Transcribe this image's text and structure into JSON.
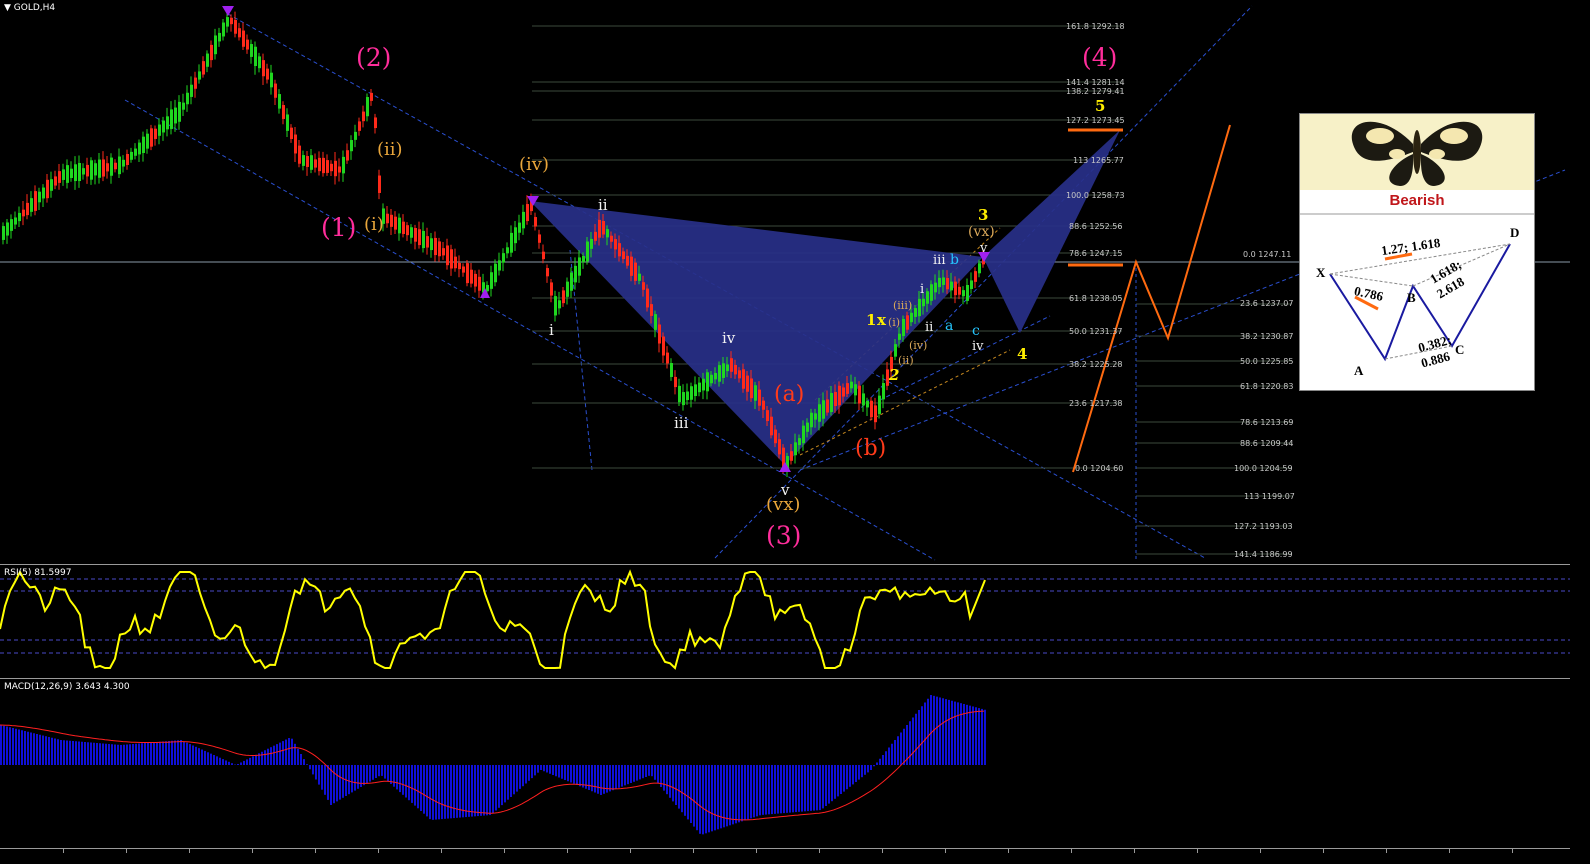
{
  "window": {
    "symbol_label": "GOLD,H4"
  },
  "indicators": {
    "rsi_label": "RSI(5) 81.5997",
    "macd_label": "MACD(12,26,9) 3.643 4.300"
  },
  "colors": {
    "bull_candle": "#1fd71f",
    "bear_candle": "#ff2a1a",
    "rsi_line": "#ffff00",
    "macd_hist": "#1010d8",
    "macd_signal": "#ff2020",
    "pattern_fill": "#283089",
    "projection": "#ff6a10",
    "channel": "#2a4fd0"
  },
  "fib_left": [
    "161.8 1292.18",
    "141.4 1281.14",
    "138.2 1279.41",
    "127.2 1273.45",
    "113 1265.77",
    "100.0 1258.73",
    "88.6 1252.56",
    "78.6 1247.15",
    "61.8 1238.05",
    "50.0 1231.37",
    "38.2 1225.28",
    "23.6 1217.38",
    "0.0 1204.60"
  ],
  "fib_right": [
    "0.0 1247.11",
    "23.6 1237.07",
    "38.2 1230.87",
    "50.0 1225.85",
    "61.8 1220.83",
    "78.6 1213.69",
    "88.6 1209.44",
    "100.0 1204.59",
    "113 1199.07",
    "127.2 1193.03",
    "141.4 1186.99"
  ],
  "waves": {
    "p1": "(1)",
    "p2": "(2)",
    "p3": "(3)",
    "p4": "(4)",
    "iv_o": "(iv)",
    "ii_o": "(ii)",
    "i_o": "(i)",
    "vx_o": "(vx)",
    "vx_o2": "(vx)",
    "a_r": "(a)",
    "b_r": "(b)",
    "i_w": "i",
    "ii_w": "ii",
    "iii_w": "iii",
    "iv_w": "iv",
    "v_w": "v",
    "i2": "i",
    "ii2": "ii",
    "iii2": "iii",
    "iv2": "iv",
    "v2": "v",
    "y1": "1",
    "x1": "x",
    "y2": "2",
    "y3": "3",
    "y4": "4",
    "y5": "5",
    "ai": "(i)",
    "aii": "(ii)",
    "aiii": "(iii)",
    "aiv": "(iv)",
    "ca": "a",
    "cb": "b",
    "cc": "c"
  },
  "inset": {
    "label": "Bearish",
    "points": {
      "x": "X",
      "a": "A",
      "b": "B",
      "c": "C",
      "d": "D"
    },
    "ratios": {
      "xb": "0.786",
      "xd": "1.27; 1.618",
      "bc": "0.382;",
      "bc2": "0.886",
      "cd": "1.618;",
      "cd2": "2.618"
    }
  }
}
